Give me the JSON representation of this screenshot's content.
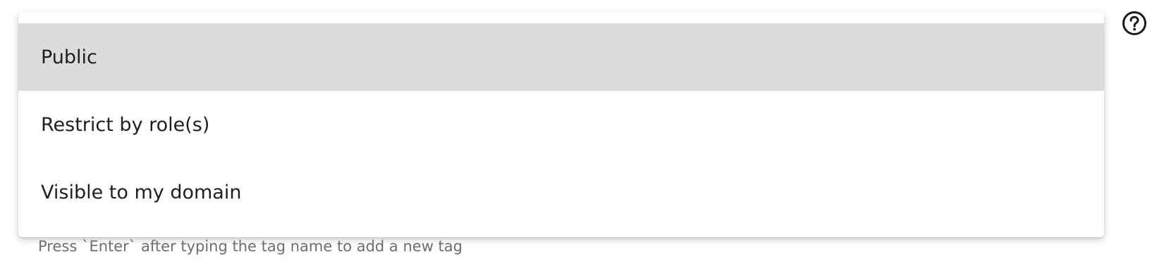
{
  "visibility_menu": {
    "options": [
      {
        "label": "Public",
        "highlighted": true
      },
      {
        "label": "Restrict by role(s)",
        "highlighted": false
      },
      {
        "label": "Visible to my domain",
        "highlighted": false
      }
    ]
  },
  "tags": {
    "hint": "Press `Enter` after typing the tag name to add a new tag"
  },
  "icons": {
    "help": "question-circle-icon"
  },
  "colors": {
    "highlight": "#dcdcdc",
    "text": "#1f1f1f",
    "hint_text": "#6e6e6e"
  }
}
